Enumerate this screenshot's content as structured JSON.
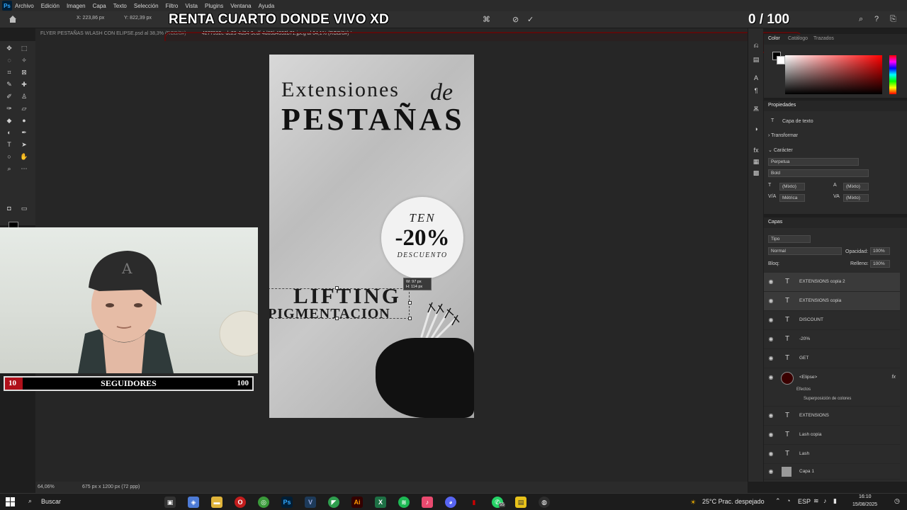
{
  "menubar": {
    "items": [
      "Archivo",
      "Edición",
      "Imagen",
      "Capa",
      "Texto",
      "Selección",
      "Filtro",
      "Vista",
      "Plugins",
      "Ventana",
      "Ayuda"
    ]
  },
  "options": {
    "x_field": "X: 223,86 px",
    "y_field": "Y: 822,39 px",
    "overlay_title": "RENTA CUARTO DONDE VIVO XD",
    "overlay_counter": "0  / 100"
  },
  "tabs": [
    {
      "label": "FLYER PESTAÑAS WLASH CON ELIPSE.psd al 38,3% (RGB/8#)",
      "active": false
    },
    {
      "label": "4277592e-dc29-4d34-9edf-4d65b4392b71.jpeg al 64,1% (RGB/8#) *",
      "active": true
    }
  ],
  "artboard": {
    "line1": "Extensiones",
    "line1_italic": "de",
    "line2": "PESTAÑAS",
    "badge_top": "TEN",
    "badge_value": "-20%",
    "badge_bottom": "DESCUENTO",
    "lift_text": "LIFTING",
    "pig_text": "PIGMENTACION",
    "dims_w": "W: 97 px",
    "dims_h": "H: 114 px"
  },
  "color_panel": {
    "tabs": [
      "Color",
      "Catálogo",
      "Trazados"
    ],
    "hue_color": "#ff0000"
  },
  "properties": {
    "title": "Propiedades",
    "layer_kind": "Capa de texto",
    "transform_label": "Transformar",
    "char_label": "Carácter",
    "font_family": "Perpetua",
    "font_style": "Bold",
    "size_value": "(Mixto)",
    "leading_value": "(Mixto)",
    "kerning_value": "Métrica",
    "tracking_value": "(Mixto)"
  },
  "layers_panel": {
    "title": "Capas",
    "search_placeholder": "Tipo",
    "blend_mode": "Normal",
    "opacity_label": "Opacidad:",
    "opacity_value": "100%",
    "lock_label": "Bloq:",
    "fill_label": "Relleno:",
    "fill_value": "100%",
    "layers": [
      {
        "name": "EXTENSIONS copia 2",
        "type": "text",
        "selected": true
      },
      {
        "name": "EXTENSIONS copia",
        "type": "text",
        "selected": true
      },
      {
        "name": "DISCOUNT",
        "type": "text",
        "selected": false
      },
      {
        "name": "-20%",
        "type": "text",
        "selected": false
      },
      {
        "name": "GET",
        "type": "text",
        "selected": false
      },
      {
        "name": "<Elipse>",
        "type": "shape",
        "selected": false
      },
      {
        "name": "EXTENSIONS",
        "type": "text",
        "selected": false
      },
      {
        "name": "Lash copia",
        "type": "text",
        "selected": false
      },
      {
        "name": "Lash",
        "type": "text",
        "selected": false
      },
      {
        "name": "Capa 1",
        "type": "pixel",
        "selected": false
      }
    ],
    "effects_label": "Efectos",
    "effect_item": "Superposición de colores"
  },
  "status": {
    "zoom": "64,06%",
    "doc_size": "675 px x 1200 px (72 ppp)"
  },
  "webcam": {
    "followers_current": "10",
    "followers_label": "SEGUIDORES",
    "followers_goal": "100"
  },
  "taskbar": {
    "search_label": "Buscar",
    "weather": "25°C  Prac. despejado",
    "lang": "ESP",
    "time": "16:10",
    "date": "15/08/2025",
    "whatsapp_badge": "55"
  }
}
